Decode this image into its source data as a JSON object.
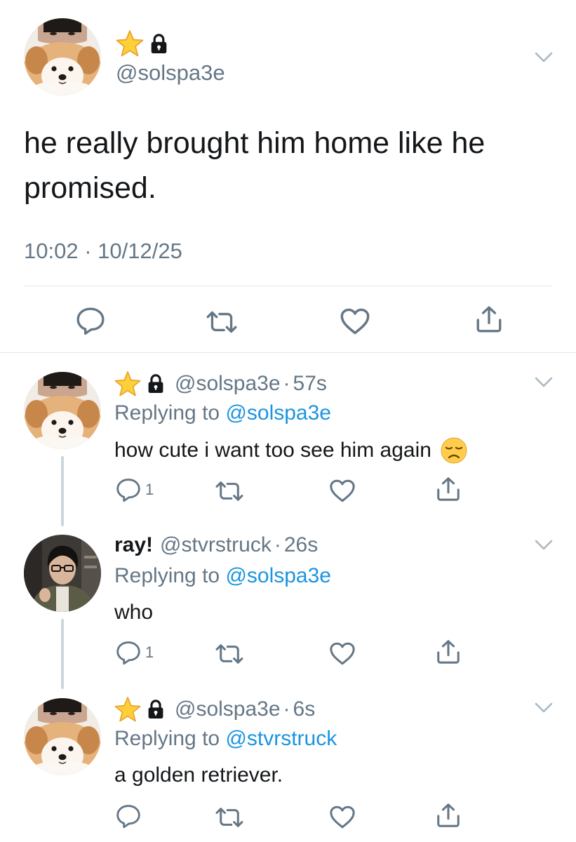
{
  "main_tweet": {
    "handle": "@solspa3e",
    "badges": [
      "star-icon",
      "lock-icon"
    ],
    "text": "he really brought him home like he promised.",
    "time": "10:02",
    "separator": "·",
    "date": "10/12/25"
  },
  "replies": [
    {
      "name": "",
      "handle": "@solspa3e",
      "time": "57s",
      "badges": [
        "star-icon",
        "lock-icon"
      ],
      "replying_prefix": "Replying to ",
      "replying_to": "@solspa3e",
      "text": "how cute i want too see him again",
      "emoji": "disappointed-face-icon",
      "reply_count": "1"
    },
    {
      "name": "ray!",
      "handle": "@stvrstruck",
      "time": "26s",
      "replying_prefix": "Replying to ",
      "replying_to": "@solspa3e",
      "text": "who",
      "reply_count": "1"
    },
    {
      "name": "",
      "handle": "@solspa3e",
      "time": "6s",
      "badges": [
        "star-icon",
        "lock-icon"
      ],
      "replying_prefix": "Replying to ",
      "replying_to": "@stvrstruck",
      "text": "a golden retriever.",
      "reply_count": ""
    }
  ],
  "colors": {
    "text": "#14171a",
    "secondary": "#657786",
    "link": "#1b95e0",
    "divider": "#e1e8ed",
    "star": "#ffcc33"
  }
}
